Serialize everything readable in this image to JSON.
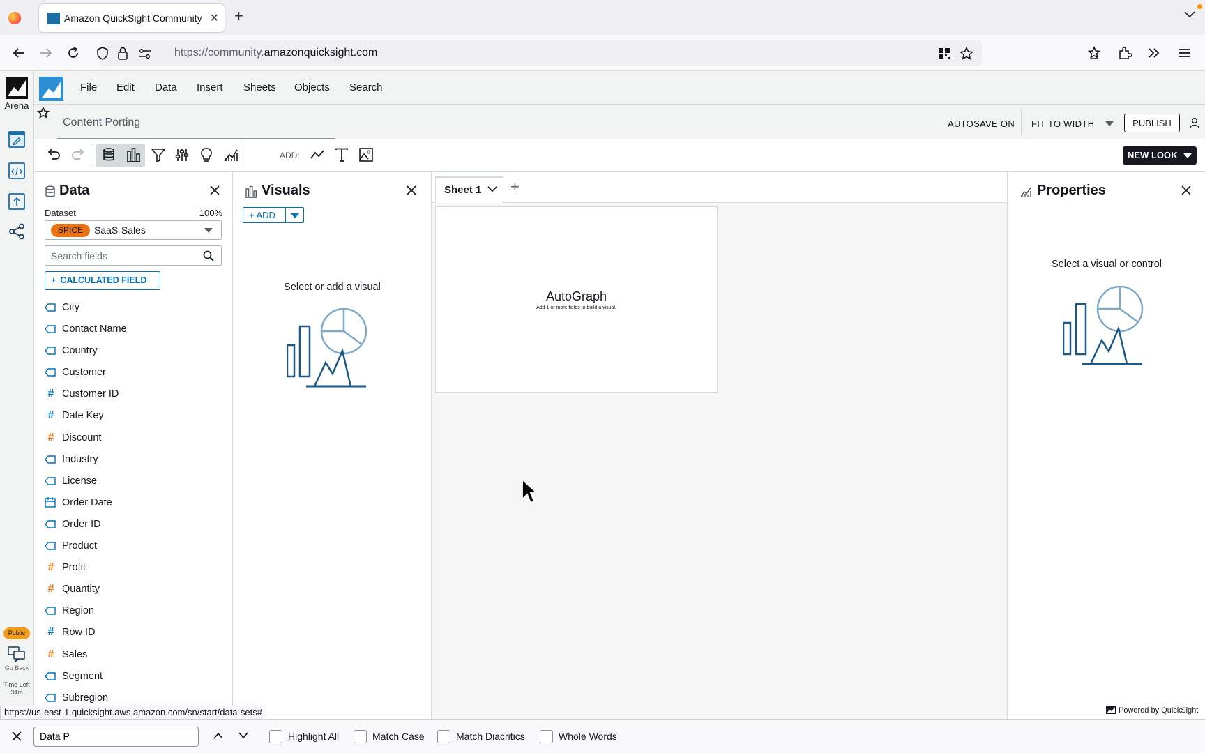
{
  "browser": {
    "tab_title": "Amazon QuickSight Community",
    "url_prefix": "https://community.",
    "url_host": "amazonquicksight.com",
    "status_url": "https://us-east-1.quicksight.aws.amazon.com/sn/start/data-sets#"
  },
  "rail": {
    "logo_label": "Arena",
    "public_badge": "Public",
    "go_back": "Go Back",
    "time_left_label": "Time Left",
    "time_left_value": "34m"
  },
  "menu": [
    "File",
    "Edit",
    "Data",
    "Insert",
    "Sheets",
    "Objects",
    "Search"
  ],
  "titlebar": {
    "analysis_name": "Content Porting",
    "autosave": "AUTOSAVE ON",
    "fit": "FIT TO WIDTH",
    "publish": "PUBLISH"
  },
  "toolbar": {
    "add_label": "ADD:",
    "new_look": "NEW LOOK"
  },
  "data_panel": {
    "title": "Data",
    "dataset_label": "Dataset",
    "dataset_pct": "100%",
    "spice": "SPICE",
    "dataset_name": "SaaS-Sales",
    "search_placeholder": "Search fields",
    "calc_field": "CALCULATED FIELD",
    "fields": [
      {
        "name": "City",
        "type": "dimension"
      },
      {
        "name": "Contact Name",
        "type": "dimension"
      },
      {
        "name": "Country",
        "type": "dimension"
      },
      {
        "name": "Customer",
        "type": "dimension"
      },
      {
        "name": "Customer ID",
        "type": "id"
      },
      {
        "name": "Date Key",
        "type": "id"
      },
      {
        "name": "Discount",
        "type": "measure"
      },
      {
        "name": "Industry",
        "type": "dimension"
      },
      {
        "name": "License",
        "type": "dimension"
      },
      {
        "name": "Order Date",
        "type": "date"
      },
      {
        "name": "Order ID",
        "type": "dimension"
      },
      {
        "name": "Product",
        "type": "dimension"
      },
      {
        "name": "Profit",
        "type": "measure"
      },
      {
        "name": "Quantity",
        "type": "measure"
      },
      {
        "name": "Region",
        "type": "dimension"
      },
      {
        "name": "Row ID",
        "type": "id"
      },
      {
        "name": "Sales",
        "type": "measure"
      },
      {
        "name": "Segment",
        "type": "dimension"
      },
      {
        "name": "Subregion",
        "type": "dimension"
      }
    ]
  },
  "visuals_panel": {
    "title": "Visuals",
    "add": "+ ADD",
    "empty": "Select or add a visual"
  },
  "canvas": {
    "sheet_tab": "Sheet 1",
    "autograph_title": "AutoGraph",
    "autograph_sub": "Add 1 or more fields to build a visual."
  },
  "properties": {
    "title": "Properties",
    "empty": "Select a visual or control",
    "powered": "Powered by QuickSight"
  },
  "findbar": {
    "query": "Data P",
    "options": [
      "Highlight All",
      "Match Case",
      "Match Diacritics",
      "Whole Words"
    ]
  },
  "colors": {
    "accent": "#0073bb",
    "spice": "#ec7211",
    "illustration": "#1b5885",
    "illustration_light": "#7fa9c6"
  }
}
